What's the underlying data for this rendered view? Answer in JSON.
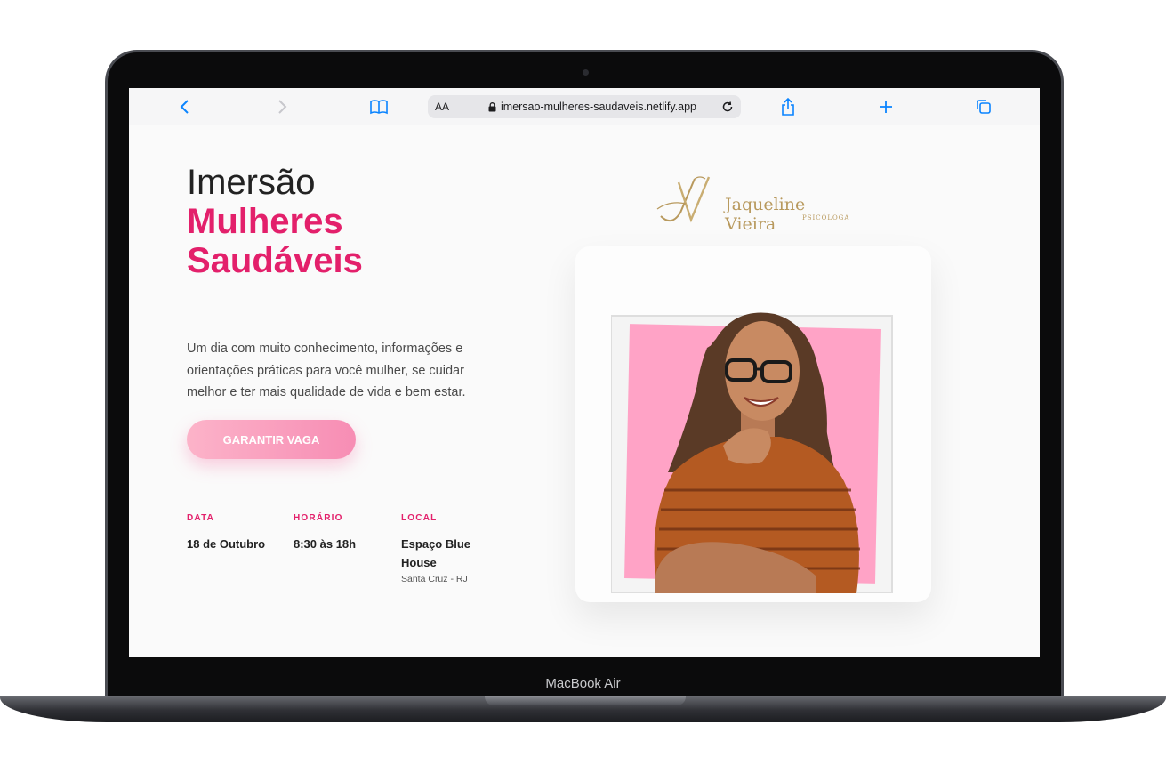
{
  "device": {
    "label": "MacBook Air"
  },
  "browser": {
    "text_size_label": "AA",
    "url": "imersao-mulheres-saudaveis.netlify.app"
  },
  "hero": {
    "title_line1": "Imersão",
    "title_line2": "Mulheres",
    "title_line3": "Saudáveis",
    "description": "Um dia com muito conhecimento, informações e orientações práticas para você mulher, se cuidar melhor e ter mais qualidade de vida e bem estar.",
    "cta_label": "GARANTIR VAGA"
  },
  "details": {
    "date": {
      "label": "DATA",
      "value": "18 de Outubro"
    },
    "time": {
      "label": "HORÁRIO",
      "value": "8:30 às 18h"
    },
    "place": {
      "label": "LOCAL",
      "value": "Espaço Blue House",
      "sub": "Santa Cruz - RJ"
    }
  },
  "brand": {
    "name": "Jaqueline Vieira",
    "role": "PSICÓLOGA",
    "accent_color": "#e3206b",
    "gold_color": "#b8995d",
    "photo_bg_color": "#ffa3c6"
  }
}
